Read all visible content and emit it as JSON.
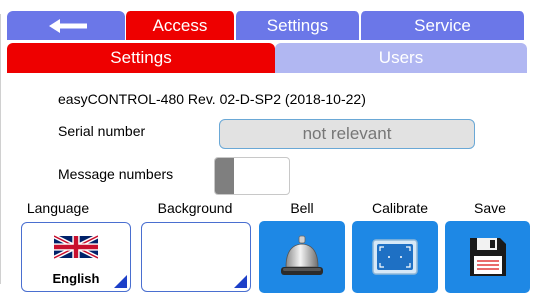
{
  "top_tabs": [
    {
      "label": "Access",
      "active": true
    },
    {
      "label": "Settings",
      "active": false
    },
    {
      "label": "Service",
      "active": false
    }
  ],
  "sub_tabs": [
    {
      "label": "Settings",
      "active": true
    },
    {
      "label": "Users",
      "active": false
    }
  ],
  "device": {
    "info": "easyCONTROL-480  Rev. 02-D-SP2  (2018-10-22)"
  },
  "serial": {
    "label": "Serial number",
    "value": "not relevant"
  },
  "message_numbers": {
    "label": "Message numbers",
    "enabled": false
  },
  "bottom_actions": {
    "language": {
      "label": "Language",
      "value": "English"
    },
    "background": {
      "label": "Background"
    },
    "bell": {
      "label": "Bell"
    },
    "calibrate": {
      "label": "Calibrate"
    },
    "save": {
      "label": "Save"
    }
  },
  "colors": {
    "active_tab": "#ee0000",
    "tab": "#6b77e8",
    "inactive_subtab": "#b1b7f2",
    "button_blue": "#1e88e5"
  },
  "icons": {
    "back": "back-arrow-icon",
    "language": "uk-flag-icon",
    "bell": "bell-icon",
    "calibrate": "calibrate-screen-icon",
    "save": "floppy-disk-icon"
  }
}
